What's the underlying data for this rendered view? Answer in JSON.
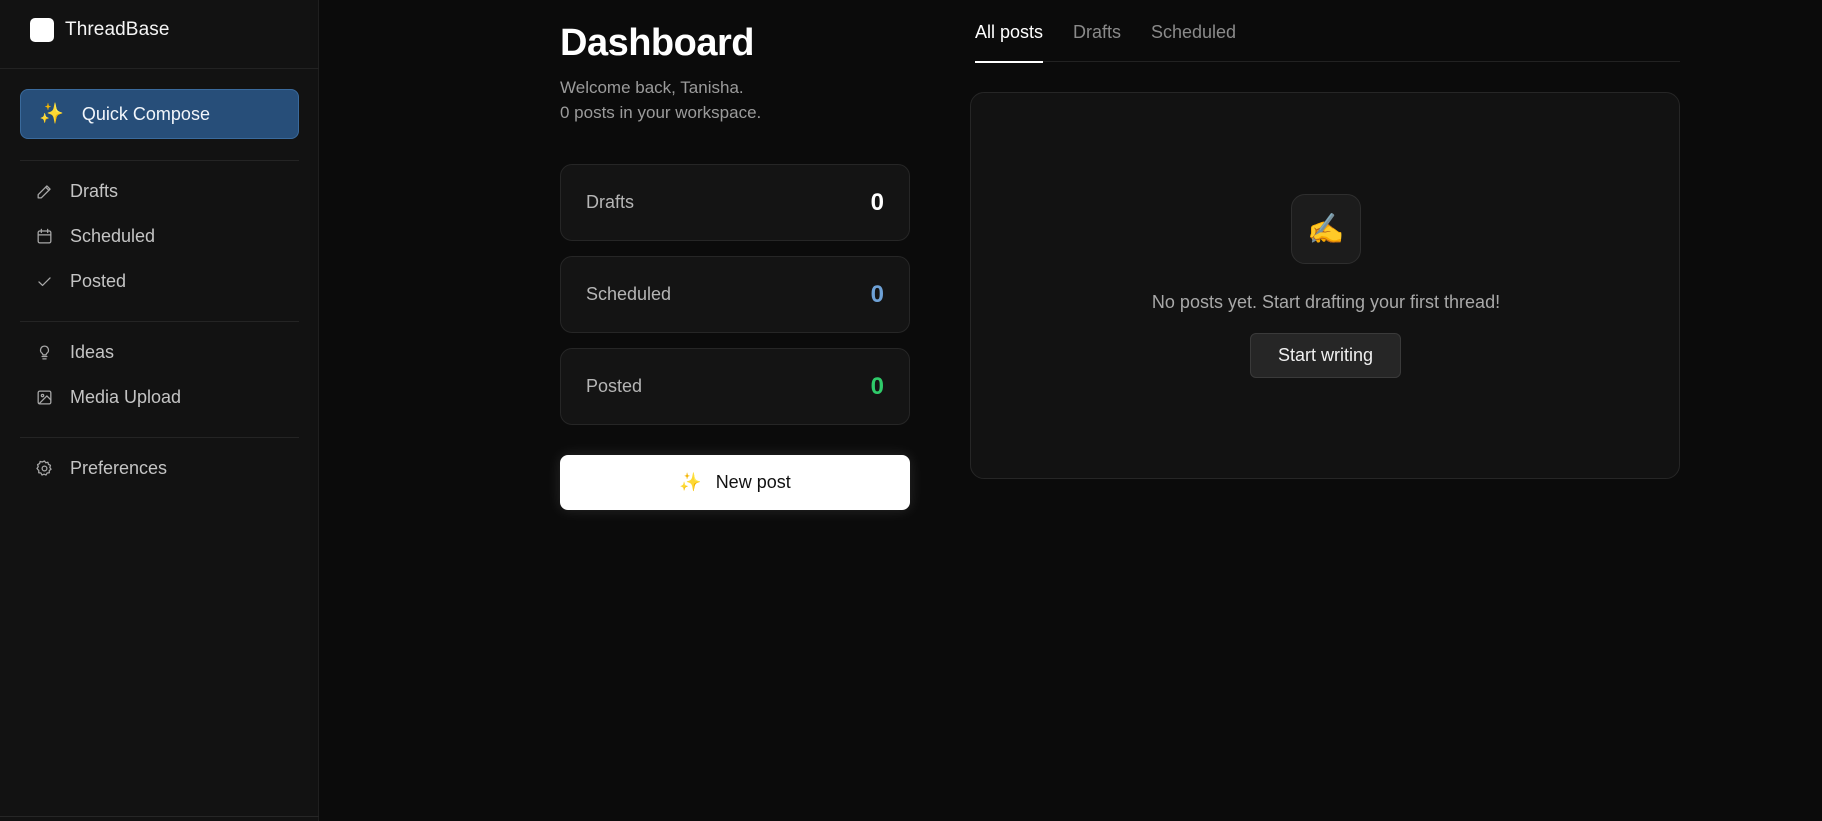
{
  "app": {
    "name": "ThreadBase"
  },
  "sidebar": {
    "quick_compose": {
      "icon": "sparkles-icon",
      "glyph": "✨",
      "label": "Quick Compose"
    },
    "items": [
      {
        "label": "Drafts",
        "icon": "pencil-icon"
      },
      {
        "label": "Scheduled",
        "icon": "calendar-icon"
      },
      {
        "label": "Posted",
        "icon": "check-icon"
      },
      {
        "label": "Ideas",
        "icon": "lightbulb-icon"
      },
      {
        "label": "Media Upload",
        "icon": "image-icon"
      },
      {
        "label": "Preferences",
        "icon": "gear-icon"
      }
    ]
  },
  "main": {
    "title": "Dashboard",
    "welcome": "Welcome back, Tanisha.",
    "post_count": "0 posts in your workspace.",
    "stats": [
      {
        "label": "Drafts",
        "value": "0",
        "color": "#ffffff"
      },
      {
        "label": "Scheduled",
        "value": "0",
        "color": "#6ea1d6"
      },
      {
        "label": "Posted",
        "value": "0",
        "color": "#2fcb6a"
      }
    ],
    "new_post": {
      "icon": "sparkles-icon",
      "glyph": "✨",
      "label": "New post"
    }
  },
  "tabs": [
    {
      "label": "All posts",
      "active": true
    },
    {
      "label": "Drafts",
      "active": false
    },
    {
      "label": "Scheduled",
      "active": false
    }
  ],
  "empty_state": {
    "icon": "writing-hand-icon",
    "glyph": "✍️",
    "message": "No posts yet. Start drafting your first thread!",
    "button_label": "Start writing"
  },
  "colors": {
    "accent": "#274e79",
    "background": "#0b0b0b",
    "sidebar": "#121212"
  }
}
